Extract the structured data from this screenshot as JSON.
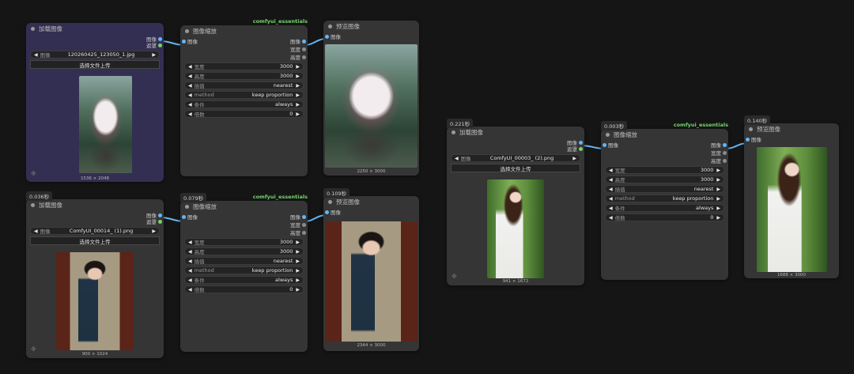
{
  "colors": {
    "canvas_bg": "#151515",
    "node_bg": "#353535",
    "selected_node_bg": "#332f52",
    "image_link": "#64b5f6",
    "mask_slot": "#7ccf6a",
    "source_tag": "#74d46c"
  },
  "load_nodes": [
    {
      "title": "加载图像",
      "timing": "",
      "out_image": "图像",
      "out_mask": "遮罩",
      "file_label": "图像",
      "file_value": "120260425_123050_1.jpg",
      "upload_label": "选择文件上传",
      "dims": "1536 × 2048",
      "image_icon": "dragon-image"
    },
    {
      "title": "加载图像",
      "timing": "0.036秒",
      "out_image": "图像",
      "out_mask": "遮罩",
      "file_label": "图像",
      "file_value": "ComfyUI_00014_ (1).png",
      "upload_label": "选择文件上传",
      "dims": "900 × 1024",
      "image_icon": "qipao-woman-image"
    },
    {
      "title": "加载图像",
      "timing": "0.221秒",
      "out_image": "图像",
      "out_mask": "遮罩",
      "file_label": "图像",
      "file_value": "ComfyUI_00003_ (2).png",
      "upload_label": "选择文件上传",
      "dims": "941 × 1672",
      "image_icon": "white-dress-woman-image"
    }
  ],
  "resize_nodes": [
    {
      "title": "图像缩放",
      "timing": "",
      "source": "comfyui_essentials",
      "in_image": "图像",
      "out_image": "图像",
      "out_width": "宽度",
      "out_height": "高度",
      "widgets": [
        {
          "label": "宽度",
          "value": "3000"
        },
        {
          "label": "高度",
          "value": "3000"
        },
        {
          "label": "插值",
          "value": "nearest"
        },
        {
          "label": "method",
          "value": "keep proportion"
        },
        {
          "label": "条件",
          "value": "always"
        },
        {
          "label": "倍数",
          "value": "0"
        }
      ]
    },
    {
      "title": "图像缩放",
      "timing": "0.079秒",
      "source": "comfyui_essentials",
      "in_image": "图像",
      "out_image": "图像",
      "out_width": "宽度",
      "out_height": "高度",
      "widgets": [
        {
          "label": "宽度",
          "value": "3000"
        },
        {
          "label": "高度",
          "value": "3000"
        },
        {
          "label": "插值",
          "value": "nearest"
        },
        {
          "label": "method",
          "value": "keep proportion"
        },
        {
          "label": "条件",
          "value": "always"
        },
        {
          "label": "倍数",
          "value": "0"
        }
      ]
    },
    {
      "title": "图像缩放",
      "timing": "0.003秒",
      "source": "comfyui_essentials",
      "in_image": "图像",
      "out_image": "图像",
      "out_width": "宽度",
      "out_height": "高度",
      "widgets": [
        {
          "label": "宽度",
          "value": "3000"
        },
        {
          "label": "高度",
          "value": "3000"
        },
        {
          "label": "插值",
          "value": "nearest"
        },
        {
          "label": "method",
          "value": "keep proportion"
        },
        {
          "label": "条件",
          "value": "always"
        },
        {
          "label": "倍数",
          "value": "0"
        }
      ]
    }
  ],
  "preview_nodes": [
    {
      "title": "预览图像",
      "timing": "",
      "in_image": "图像",
      "dims": "2250 × 3000",
      "image_icon": "dragon-image"
    },
    {
      "title": "预览图像",
      "timing": "0.109秒",
      "in_image": "图像",
      "dims": "2344 × 3000",
      "image_icon": "qipao-woman-image"
    },
    {
      "title": "预览图像",
      "timing": "0.140秒",
      "in_image": "图像",
      "dims": "1688 × 3000",
      "image_icon": "white-dress-woman-image"
    }
  ]
}
